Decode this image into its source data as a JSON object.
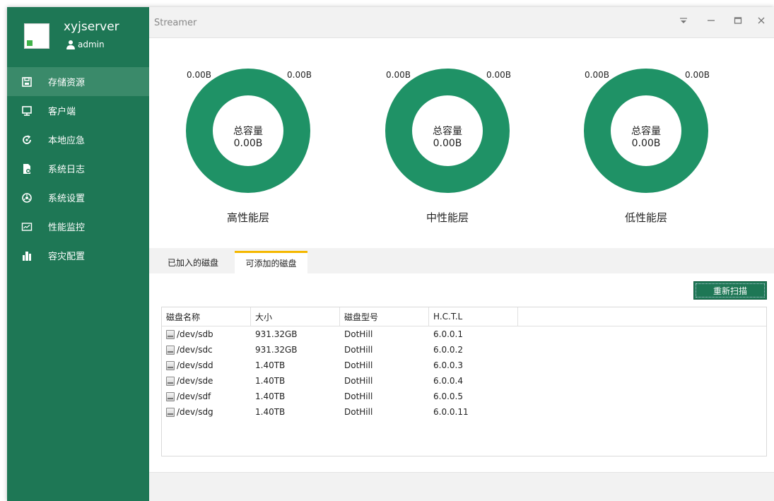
{
  "sidebar": {
    "server_name": "xyjserver",
    "user": "admin",
    "items": [
      {
        "label": "存储资源",
        "icon": "save-icon",
        "active": true
      },
      {
        "label": "客户端",
        "icon": "monitor-icon",
        "active": false
      },
      {
        "label": "本地应急",
        "icon": "restore-icon",
        "active": false
      },
      {
        "label": "系统日志",
        "icon": "log-file-icon",
        "active": false
      },
      {
        "label": "系统设置",
        "icon": "settings-icon",
        "active": false
      },
      {
        "label": "性能监控",
        "icon": "chart-monitor-icon",
        "active": false
      },
      {
        "label": "容灾配置",
        "icon": "buildings-icon",
        "active": false
      }
    ]
  },
  "window": {
    "title": "Streamer",
    "controls": [
      "menu-icon",
      "minimize-icon",
      "maximize-icon",
      "close-icon"
    ]
  },
  "tiers": [
    {
      "left_label": "0.00B",
      "right_label": "0.00B",
      "center_title": "总容量",
      "center_value": "0.00B",
      "tier_name": "高性能层"
    },
    {
      "left_label": "0.00B",
      "right_label": "0.00B",
      "center_title": "总容量",
      "center_value": "0.00B",
      "tier_name": "中性能层"
    },
    {
      "left_label": "0.00B",
      "right_label": "0.00B",
      "center_title": "总容量",
      "center_value": "0.00B",
      "tier_name": "低性能层"
    }
  ],
  "tabs": [
    {
      "label": "已加入的磁盘",
      "active": false
    },
    {
      "label": "可添加的磁盘",
      "active": true
    }
  ],
  "rescan_label": "重新扫描",
  "table": {
    "headers": [
      "磁盘名称",
      "大小",
      "磁盘型号",
      "H.C.T.L",
      ""
    ],
    "rows": [
      [
        "/dev/sdb",
        "931.32GB",
        "DotHill",
        "6.0.0.1"
      ],
      [
        "/dev/sdc",
        "931.32GB",
        "DotHill",
        "6.0.0.2"
      ],
      [
        "/dev/sdd",
        "1.40TB",
        "DotHill",
        "6.0.0.3"
      ],
      [
        "/dev/sde",
        "1.40TB",
        "DotHill",
        "6.0.0.4"
      ],
      [
        "/dev/sdf",
        "1.40TB",
        "DotHill",
        "6.0.0.5"
      ],
      [
        "/dev/sdg",
        "1.40TB",
        "DotHill",
        "6.0.0.11"
      ]
    ]
  },
  "colors": {
    "sidebar_bg": "#1e7755",
    "sidebar_active": "#3a8a6a",
    "donut": "#1f9266",
    "tab_accent": "#f5b800",
    "button_bg": "#1e7755"
  }
}
